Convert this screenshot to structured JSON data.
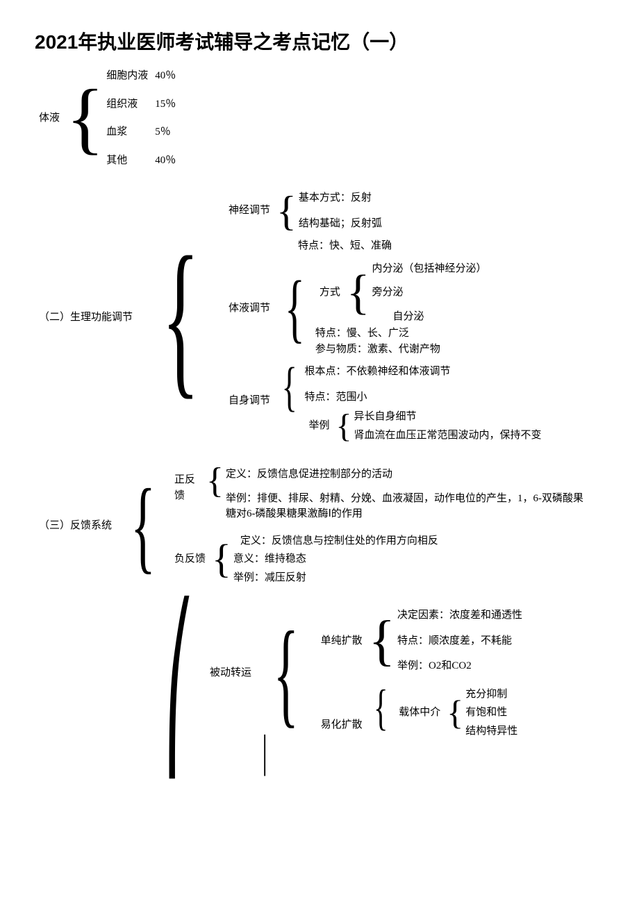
{
  "title": "2021年执业医师考试辅导之考点记忆（一）",
  "s1": {
    "root": "体液",
    "items": [
      {
        "k": "细胞内液",
        "v": "40％"
      },
      {
        "k": "组织液",
        "v": "15％"
      },
      {
        "k": "血浆",
        "v": "5％"
      },
      {
        "k": "其他",
        "v": "40％"
      }
    ]
  },
  "s2": {
    "root": "（二）生理功能调节",
    "b1": {
      "label": "神经调节",
      "l1": "基本方式：反射",
      "l2": "结构基础；反射弧",
      "l3": "特点：快、短、准确"
    },
    "b2": {
      "label": "体液调节",
      "mode_label": "方式",
      "m1": "内分泌（包括神经分泌）",
      "m2": "旁分泌",
      "m3": "自分泌",
      "l1": "特点：慢、长、广泛",
      "l2": "参与物质：激素、代谢产物"
    },
    "b3": {
      "label": "自身调节",
      "l1": "根本点：不依赖神经和体液调节",
      "l2": "特点：范围小",
      "ex_label": "举例",
      "e1": "异长自身细节",
      "e2": "肾血流在血压正常范围波动内，保持不变"
    }
  },
  "s3": {
    "root": "（三）反馈系统",
    "pos": {
      "label": "正反馈",
      "l1": "定义：反馈信息促进控制部分的活动",
      "l2": "举例：排便、排尿、射精、分娩、血液凝固，动作电位的产生，1，6-双磷酸果糖对6-磷酸果糖果激酶Ⅰ的作用"
    },
    "neg": {
      "label": "负反馈",
      "l1": "定义：反馈信息与控制住处的作用方向相反",
      "l2": "意义：维持稳态",
      "l3": "举例：减压反射"
    }
  },
  "s4": {
    "b1": {
      "label": "被动转运",
      "sd": {
        "label": "单纯扩散",
        "l1": "决定因素：浓度差和通透性",
        "l2": "特点：顺浓度差，不耗能",
        "l3": "举例：O2和CO2"
      },
      "fd": {
        "label": "易化扩散",
        "carrier_label": "载体中介",
        "c1": "充分抑制",
        "c2": "有饱和性",
        "c3": "结构特异性"
      }
    }
  }
}
